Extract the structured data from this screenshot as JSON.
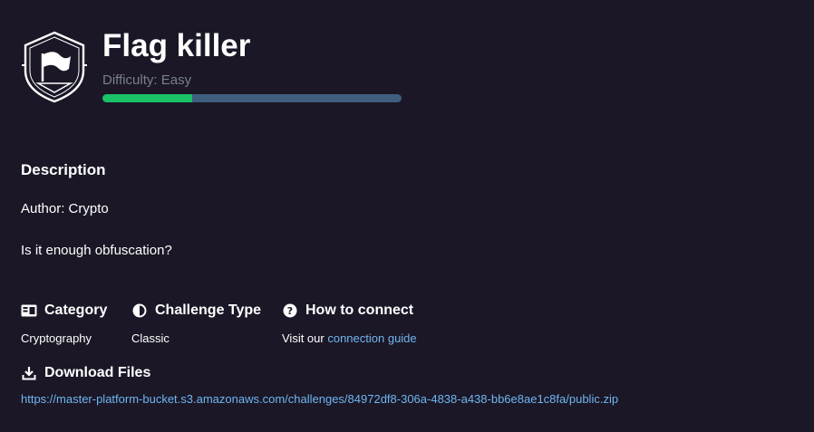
{
  "challenge": {
    "title": "Flag killer",
    "difficulty": "Difficulty: Easy",
    "difficulty_progress_fraction": 0.3
  },
  "description": {
    "heading": "Description",
    "author": "Author: Crypto",
    "body": "Is it enough obfuscation?"
  },
  "meta": {
    "category": {
      "heading": "Category",
      "value": "Cryptography",
      "icon": "id-card-icon"
    },
    "challenge_type": {
      "heading": "Challenge Type",
      "value": "Classic",
      "icon": "half-circle-icon"
    },
    "how_to_connect": {
      "heading": "How to connect",
      "prefix": "Visit our ",
      "link": "connection guide",
      "icon": "question-circle-icon"
    }
  },
  "download": {
    "heading": "Download Files",
    "icon": "download-icon",
    "url": "https://master-platform-bucket.s3.amazonaws.com/challenges/84972df8-306a-4838-a438-bb6e8ae1c8fa/public.zip"
  },
  "colors": {
    "background": "#1b1726",
    "progress_fill": "#1ac166",
    "progress_track": "#3f5e7e",
    "link": "#6fb6f1",
    "muted": "#7a7f8e"
  }
}
